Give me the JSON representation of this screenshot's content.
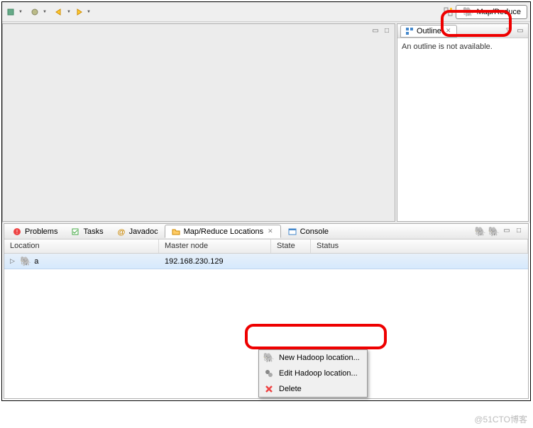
{
  "perspective": {
    "label": "Map/Reduce"
  },
  "outline": {
    "tab_label": "Outline",
    "empty_message": "An outline is not available."
  },
  "bottom_tabs": [
    {
      "label": "Problems"
    },
    {
      "label": "Tasks"
    },
    {
      "label": "Javadoc"
    },
    {
      "label": "Map/Reduce Locations"
    },
    {
      "label": "Console"
    }
  ],
  "table": {
    "columns": {
      "location": "Location",
      "master": "Master node",
      "state": "State",
      "status": "Status"
    },
    "rows": [
      {
        "name": "a",
        "master": "192.168.230.129",
        "state": "",
        "status": ""
      }
    ]
  },
  "context_menu": [
    {
      "label": "New Hadoop location..."
    },
    {
      "label": "Edit Hadoop location..."
    },
    {
      "label": "Delete"
    }
  ],
  "watermark": "@51CTO博客"
}
